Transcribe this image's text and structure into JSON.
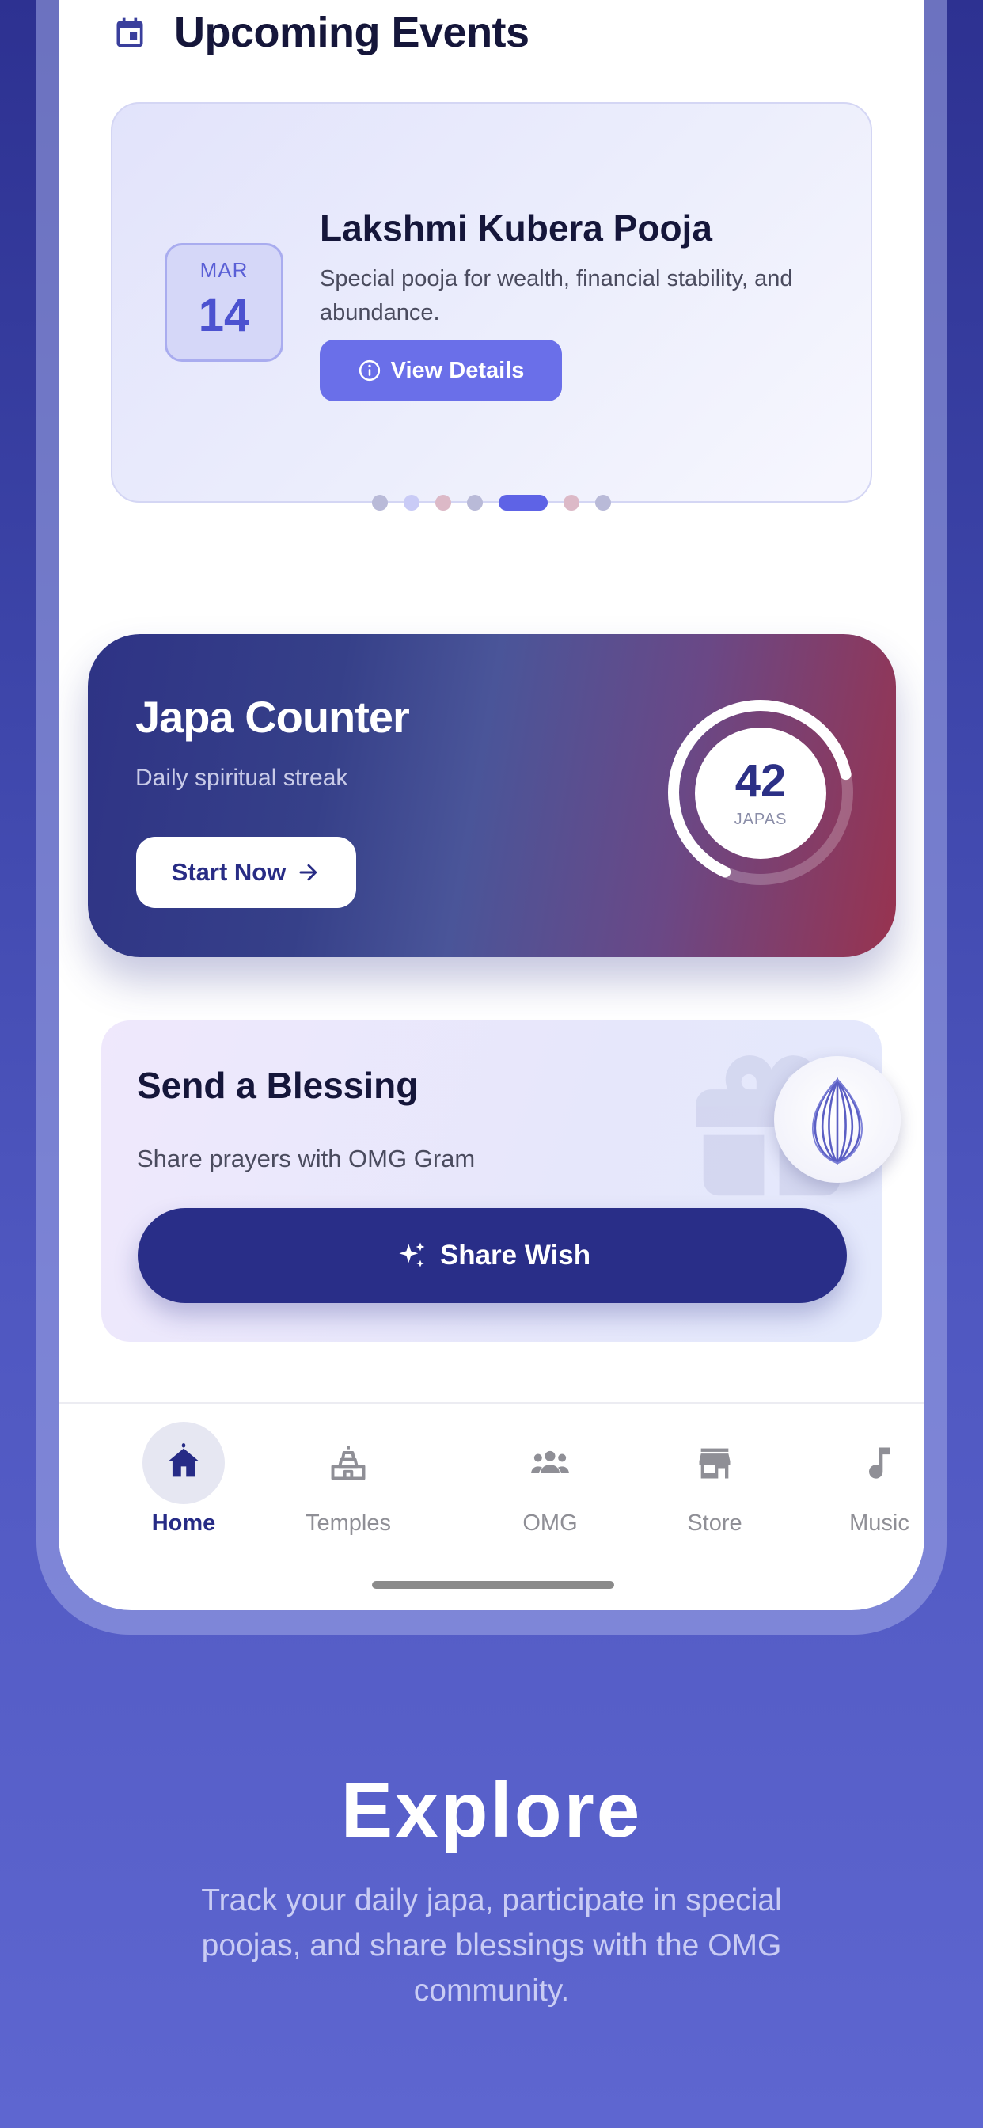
{
  "events": {
    "section_title": "Upcoming Events",
    "card": {
      "month": "MAR",
      "day": "14",
      "title": "Lakshmi Kubera Pooja",
      "description": "Special pooja for wealth, financial stability, and abundance.",
      "button_label": "View Details"
    },
    "pagination": {
      "count": 7,
      "active_index": 4,
      "dot_colors": [
        "#b9bad8",
        "#c9cbf6",
        "#dcb9c7",
        "#b9bad8",
        "#5e63e6",
        "#dcb9c7",
        "#b9bad8"
      ]
    }
  },
  "japa": {
    "title": "Japa Counter",
    "subtitle": "Daily spiritual streak",
    "button_label": "Start Now",
    "count": "42",
    "unit": "JAPAS",
    "progress_fraction": 0.68
  },
  "blessing": {
    "title": "Send a Blessing",
    "subtitle": "Share prayers with OMG Gram",
    "button_label": "Share Wish"
  },
  "nav": {
    "items": [
      {
        "label": "Home",
        "icon": "home-icon",
        "active": true
      },
      {
        "label": "Temples",
        "icon": "temple-icon",
        "active": false
      },
      {
        "label": "OMG",
        "icon": "people-icon",
        "active": false
      },
      {
        "label": "Store",
        "icon": "store-icon",
        "active": false
      },
      {
        "label": "Music",
        "icon": "music-note-icon",
        "active": false
      }
    ]
  },
  "explore": {
    "title": "Explore",
    "description": "Track your daily japa, participate in special poojas, and share blessings with the OMG community."
  },
  "colors": {
    "primary": "#292e88",
    "accent": "#6a6fe9",
    "nav_active": "#262b86"
  }
}
